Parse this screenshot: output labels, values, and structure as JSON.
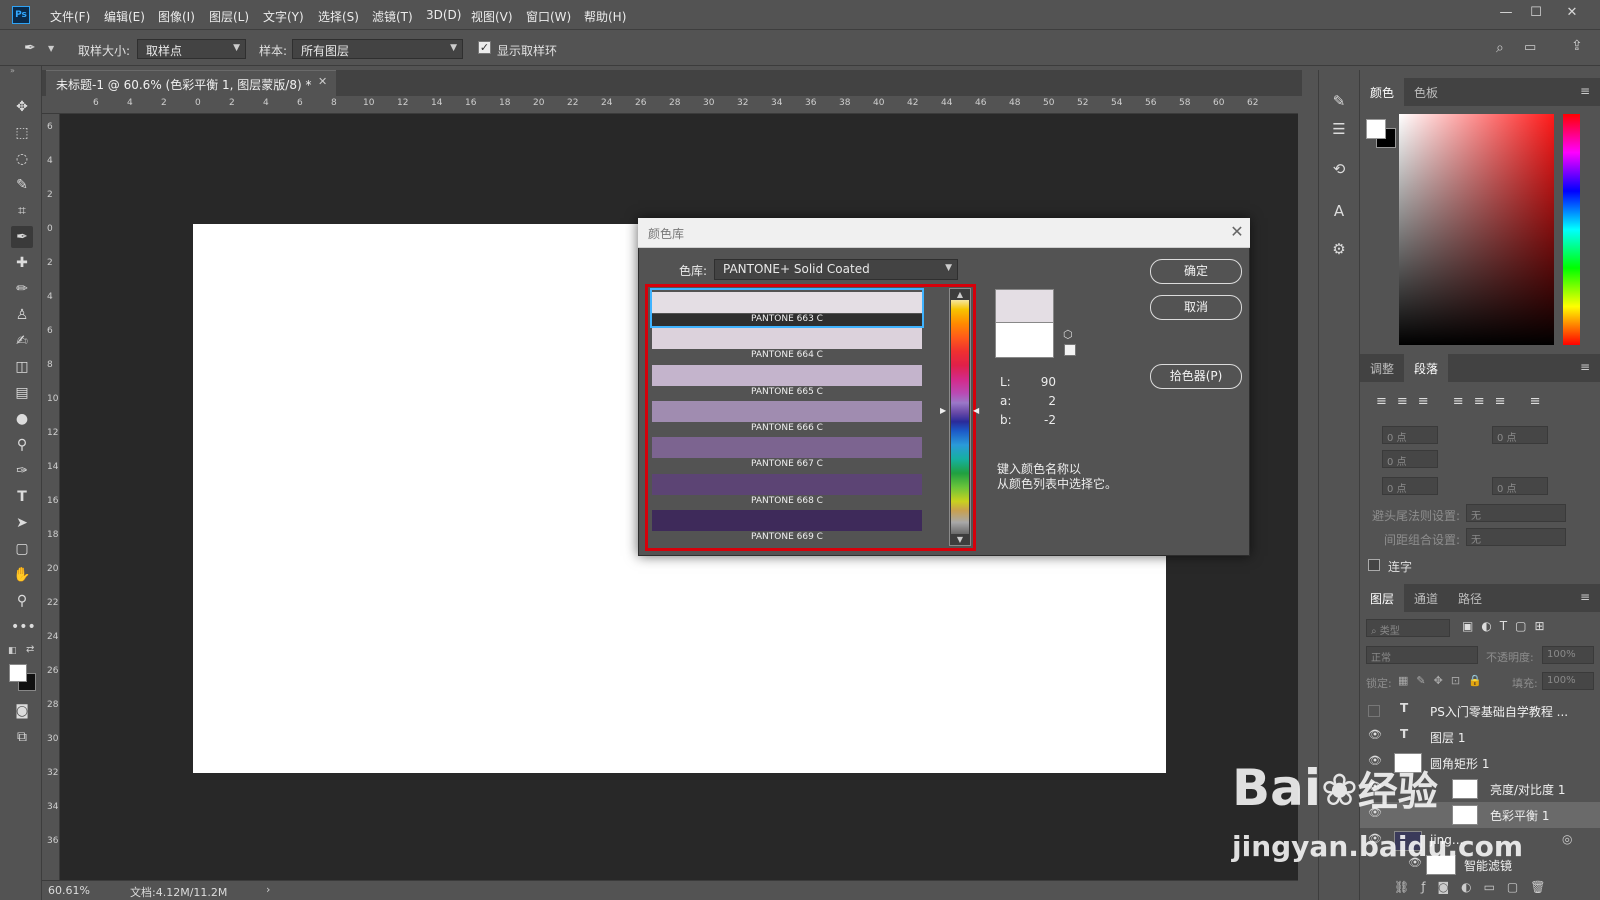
{
  "app": {
    "logo": "Ps"
  },
  "menu": [
    "文件(F)",
    "编辑(E)",
    "图像(I)",
    "图层(L)",
    "文字(Y)",
    "选择(S)",
    "滤镜(T)",
    "3D(D)",
    "视图(V)",
    "窗口(W)",
    "帮助(H)"
  ],
  "options": {
    "sample_size_label": "取样大小:",
    "sample_size_value": "取样点",
    "sample_label": "样本:",
    "sample_value": "所有图层",
    "show_ring_label": "显示取样环"
  },
  "document": {
    "tab_title": "未标题-1 @ 60.6% (色彩平衡 1, 图层蒙版/8) *",
    "zoom": "60.61%",
    "doc_info": "文档:4.12M/11.2M"
  },
  "ruler_top": [
    "6",
    "4",
    "2",
    "0",
    "2",
    "4",
    "6",
    "8",
    "10",
    "12",
    "14",
    "16",
    "18",
    "20",
    "22",
    "24",
    "26",
    "28",
    "30",
    "32",
    "34",
    "36",
    "38",
    "40",
    "42",
    "44",
    "46",
    "48",
    "50",
    "52",
    "54",
    "56",
    "58",
    "60",
    "62"
  ],
  "ruler_left": [
    "6",
    "4",
    "2",
    "0",
    "2",
    "4",
    "6",
    "8",
    "10",
    "12",
    "14",
    "16",
    "18",
    "20",
    "22",
    "24",
    "26",
    "28",
    "30",
    "32",
    "34",
    "36"
  ],
  "dialog": {
    "title": "颜色库",
    "library_label": "色库:",
    "library_value": "PANTONE+ Solid Coated",
    "swatches": [
      {
        "name": "PANTONE 663 C",
        "color": "#e4dee4"
      },
      {
        "name": "PANTONE 664 C",
        "color": "#dcd2dc"
      },
      {
        "name": "PANTONE 665 C",
        "color": "#c4b4cc"
      },
      {
        "name": "PANTONE 666 C",
        "color": "#a08cb0"
      },
      {
        "name": "PANTONE 667 C",
        "color": "#7c6490"
      },
      {
        "name": "PANTONE 668 C",
        "color": "#5c4474"
      },
      {
        "name": "PANTONE 669 C",
        "color": "#3e2a5a"
      }
    ],
    "lab": [
      {
        "label": "L:",
        "value": "90"
      },
      {
        "label": "a:",
        "value": "2"
      },
      {
        "label": "b:",
        "value": "-2"
      }
    ],
    "hint_line1": "键入颜色名称以",
    "hint_line2": "从颜色列表中选择它。",
    "ok": "确定",
    "cancel": "取消",
    "picker": "拾色器(P)"
  },
  "panels": {
    "color_tabs": [
      "颜色",
      "色板"
    ],
    "para_tabs": [
      "调整",
      "段落"
    ],
    "para_fields": [
      "0 点",
      "0 点",
      "0 点",
      "0 点",
      "0 点"
    ],
    "hyphen_label": "避头尾法则设置:",
    "hyphen_value": "无",
    "spacing_label": "间距组合设置:",
    "spacing_value": "无",
    "hyphenate": "连字",
    "layer_tabs": [
      "图层",
      "通道",
      "路径"
    ],
    "filter_kind": "类型",
    "blend_mode": "正常",
    "opacity_label": "不透明度:",
    "opacity_value": "100%",
    "lock_label": "锁定:",
    "fill_label": "填充:",
    "fill_value": "100%",
    "layers": [
      "PS入门零基础自学教程 ...",
      "图层 1",
      "圆角矩形 1",
      "亮度/对比度 1",
      "色彩平衡 1",
      "jing...",
      "智能滤镜"
    ]
  },
  "watermark": {
    "brand": "Bai",
    "brand_cn": "经验",
    "url": "jingyan.baidu.com"
  }
}
